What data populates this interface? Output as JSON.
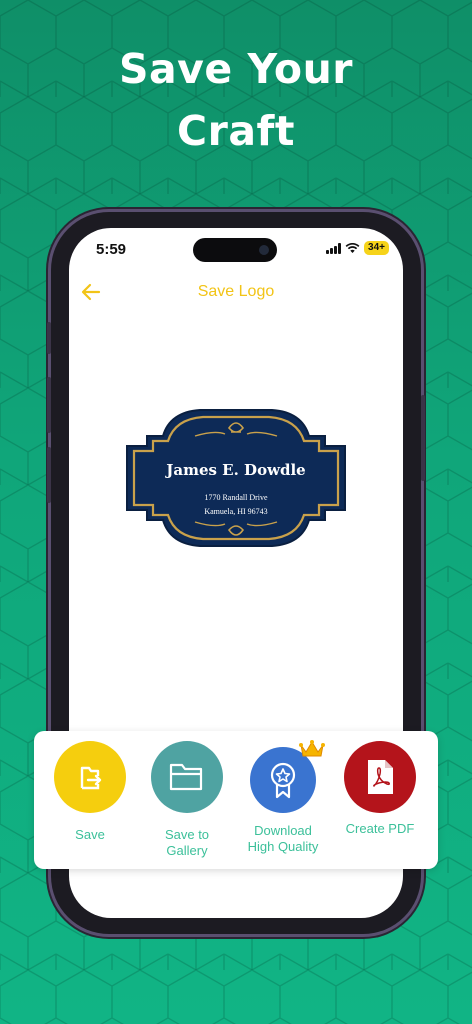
{
  "headline": {
    "line1": "Save Your",
    "line2": "Craft"
  },
  "status_bar": {
    "time": "5:59",
    "battery": "34+"
  },
  "nav": {
    "title": "Save Logo"
  },
  "logo": {
    "name": "James E. Dowdle",
    "address_line1": "1770 Randall Drive",
    "address_line2": "Kamuela, HI 96743"
  },
  "actions": [
    {
      "label_line1": "Save",
      "label_line2": "",
      "color": "#f5ce0e",
      "icon": "save-icon"
    },
    {
      "label_line1": "Save to",
      "label_line2": "Gallery",
      "color": "#4fa3a2",
      "icon": "folder-icon"
    },
    {
      "label_line1": "Download",
      "label_line2": "High Quality",
      "color": "#3a74d0",
      "icon": "badge-icon",
      "premium_icon": "crown-icon"
    },
    {
      "label_line1": "Create PDF",
      "label_line2": "",
      "color": "#b4141b",
      "icon": "pdf-icon"
    }
  ],
  "colors": {
    "background": "#10a77a",
    "accent": "#f2c417",
    "label": "#3cc09a",
    "logo_navy": "#0d2a57",
    "logo_gold": "#c9a14b"
  }
}
